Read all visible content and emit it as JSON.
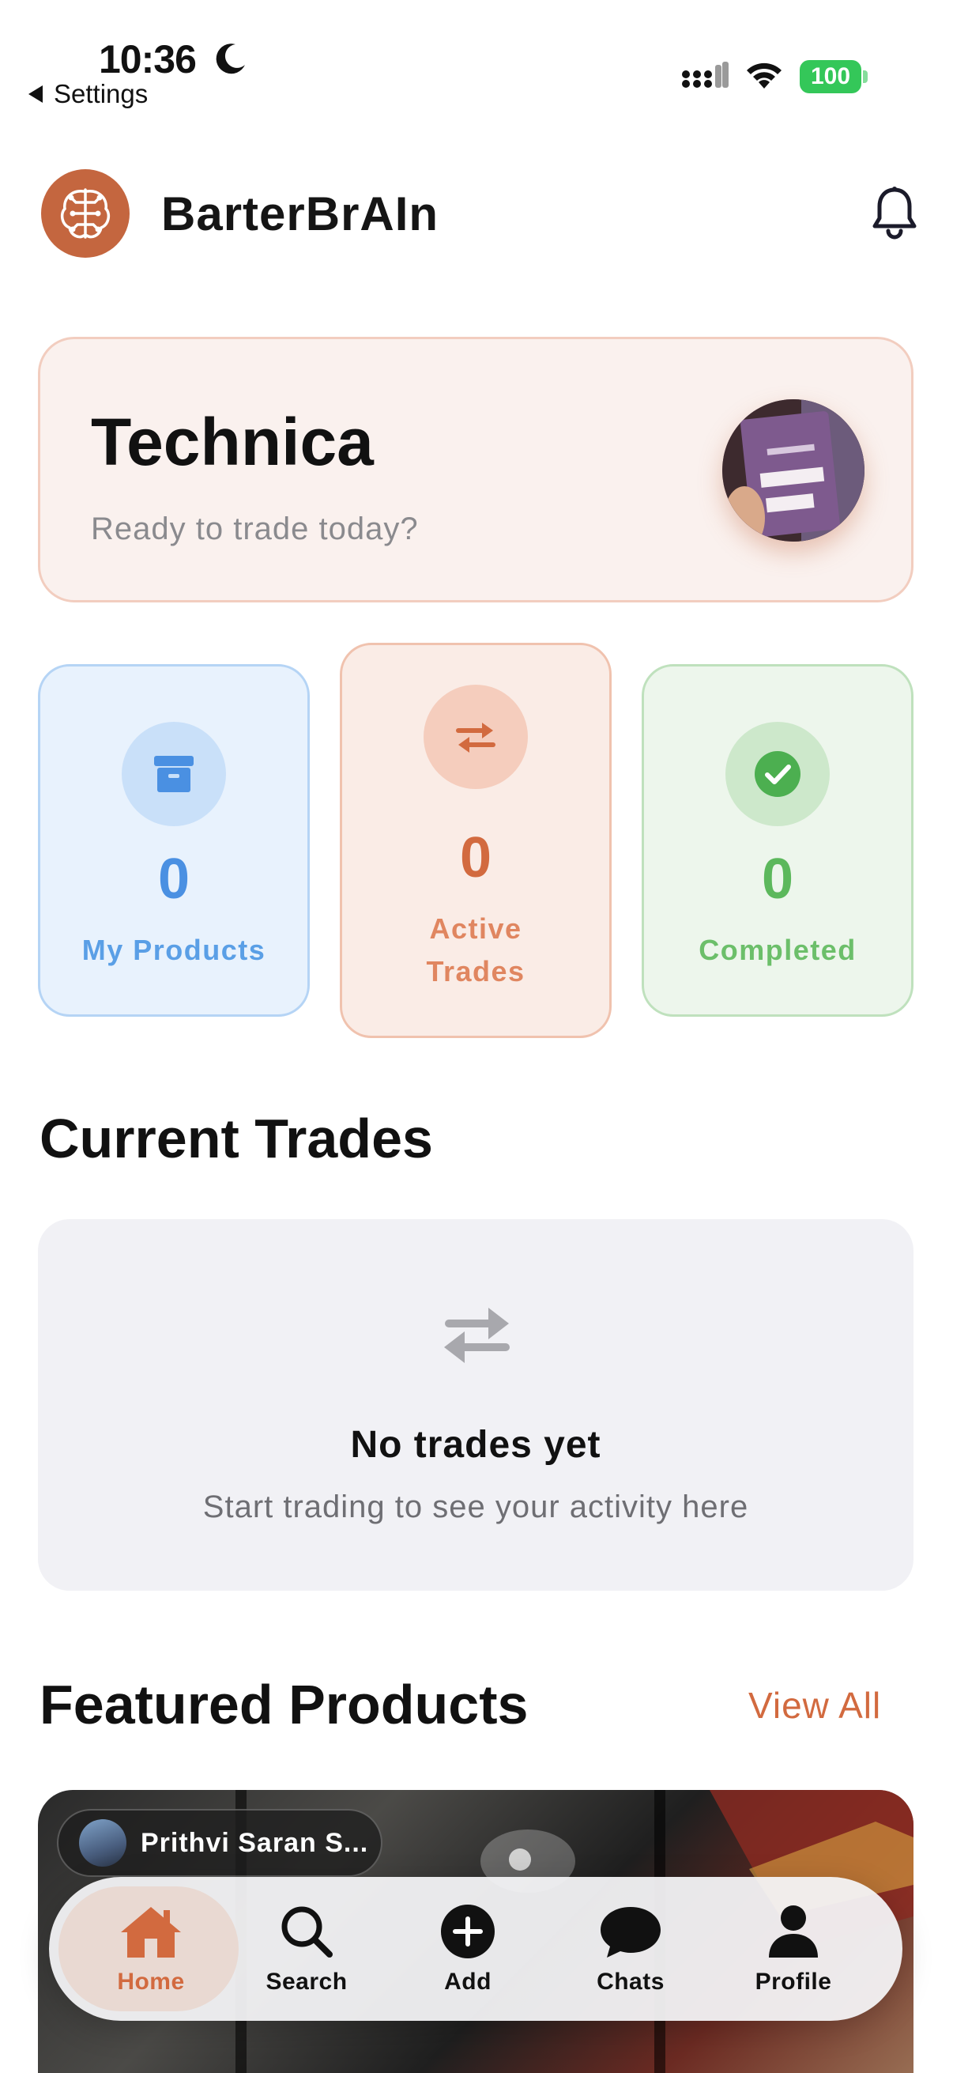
{
  "status_bar": {
    "time": "10:36",
    "back_label": "Settings",
    "battery": "100"
  },
  "header": {
    "app_name": "BarterBrAIn"
  },
  "welcome": {
    "name": "Technica",
    "subtitle": "Ready to trade today?"
  },
  "stats": {
    "my_products": {
      "value": "0",
      "label": "My Products"
    },
    "active_trades": {
      "value": "0",
      "label_line1": "Active",
      "label_line2": "Trades"
    },
    "completed": {
      "value": "0",
      "label": "Completed"
    }
  },
  "current_trades": {
    "title": "Current Trades",
    "empty_title": "No trades yet",
    "empty_subtitle": "Start trading to see your activity here"
  },
  "featured": {
    "title": "Featured Products",
    "view_all": "View All",
    "seller_name": "Prithvi Saran S..."
  },
  "tab_bar": {
    "home": "Home",
    "search": "Search",
    "add": "Add",
    "chats": "Chats",
    "profile": "Profile"
  },
  "colors": {
    "accent": "#d26a3f",
    "blue": "#4a90e2",
    "green": "#5cb85c"
  }
}
